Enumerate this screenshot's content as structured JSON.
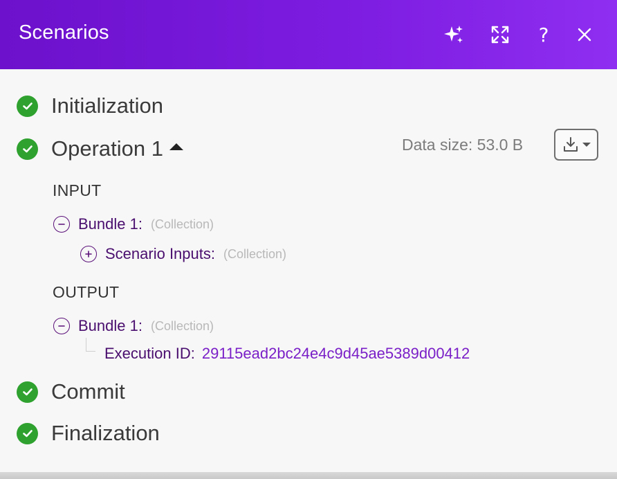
{
  "header": {
    "title": "Scenarios",
    "accent_start": "#6d11cc",
    "accent_end": "#8f2ef0",
    "icons": [
      "sparkle-icon",
      "expand-icon",
      "help-icon",
      "close-icon"
    ],
    "help_glyph": "?"
  },
  "stages": [
    {
      "label": "Initialization",
      "status": "success"
    },
    {
      "label": "Operation 1",
      "status": "success",
      "expanded": true
    },
    {
      "label": "Commit",
      "status": "success"
    },
    {
      "label": "Finalization",
      "status": "success"
    }
  ],
  "operation": {
    "data_size": "Data size: 53.0 B",
    "input": {
      "heading": "INPUT",
      "bundle_label": "Bundle 1:",
      "bundle_type": "(Collection)",
      "child_label": "Scenario Inputs:",
      "child_type": "(Collection)"
    },
    "output": {
      "heading": "OUTPUT",
      "bundle_label": "Bundle 1:",
      "bundle_type": "(Collection)",
      "field_label": "Execution ID:",
      "field_value": "29115ead2bc24e4c9d45ae5389d00412"
    }
  },
  "colors": {
    "success": "#2ea12e",
    "key": "#4a0e6e",
    "value": "#7a1fc7"
  }
}
